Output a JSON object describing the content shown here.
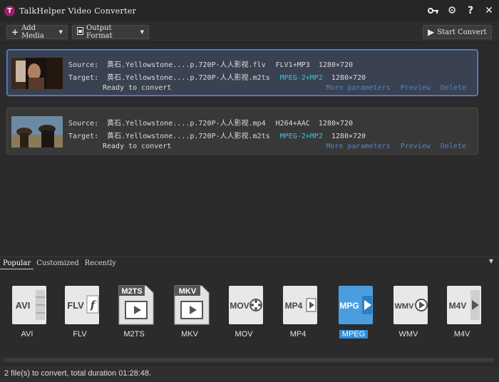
{
  "window": {
    "title": "TalkHelper Video Converter",
    "logo_letter": "T",
    "controls": {
      "key": "🔑",
      "settings": "⚙",
      "help": "?",
      "close": "✕"
    }
  },
  "toolbar": {
    "add_media": "Add Media",
    "output_format": "Output Format",
    "start_convert": "Start Convert"
  },
  "files": [
    {
      "source_label": "Source:",
      "source_name": "黄石.Yellowstone....p.720P-人人影视.flv",
      "source_format": "FLV1+MP3",
      "source_res": "1280×720",
      "target_label": "Target:",
      "target_name": "黄石.Yellowstone....p.720P-人人影视.m2ts",
      "target_format": "MPEG-2+MP2",
      "target_res": "1280×720",
      "status": "Ready to convert",
      "links": [
        "More parameters",
        "Preview",
        "Delete"
      ],
      "selected": true
    },
    {
      "source_label": "Source:",
      "source_name": "黄石.Yellowstone....p.720P-人人影视.mp4",
      "source_format": "H264+AAC",
      "source_res": "1280×720",
      "target_label": "Target:",
      "target_name": "黄石.Yellowstone....p.720P-人人影视.m2ts",
      "target_format": "MPEG-2+MP2",
      "target_res": "1280×720",
      "status": "Ready to convert",
      "links": [
        "More parameters",
        "Preview",
        "Delete"
      ],
      "selected": false
    }
  ],
  "format_tabs": [
    "Popular",
    "Customized",
    "Recently"
  ],
  "formats": [
    {
      "label": "AVI",
      "icon": "AVI"
    },
    {
      "label": "FLV",
      "icon": "FLV"
    },
    {
      "label": "M2TS",
      "icon": "M2TS"
    },
    {
      "label": "MKV",
      "icon": "MKV"
    },
    {
      "label": "MOV",
      "icon": "MOV"
    },
    {
      "label": "MP4",
      "icon": "MP4"
    },
    {
      "label": "MPEG",
      "icon": "MPG"
    },
    {
      "label": "WMV",
      "icon": "WMV"
    },
    {
      "label": "M4V",
      "icon": "M4V"
    }
  ],
  "selected_format": "MPEG",
  "status_bar": "2 file(s) to convert, total duration 01:28:48.",
  "colors": {
    "accent_cyan": "#33c6ea",
    "link_blue": "#4f86c6",
    "selection_blue": "#2f8dd9"
  }
}
